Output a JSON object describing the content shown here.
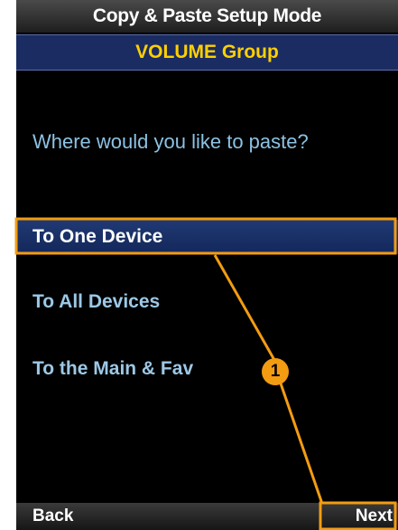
{
  "header": {
    "title": "Copy & Paste Setup Mode",
    "group": "VOLUME Group"
  },
  "prompt": "Where would you like to paste?",
  "menu": {
    "items": [
      {
        "label": "To One Device",
        "selected": true
      },
      {
        "label": "To All Devices",
        "selected": false
      },
      {
        "label": "To the Main & Fav",
        "selected": false
      }
    ]
  },
  "softkeys": {
    "back": "Back",
    "next": "Next"
  },
  "callout": {
    "number": "1",
    "color": "#f39c12"
  },
  "colors": {
    "group_text": "#ffd000",
    "selected_bg": "#1b2c63",
    "menu_text": "#9cc8e6"
  }
}
